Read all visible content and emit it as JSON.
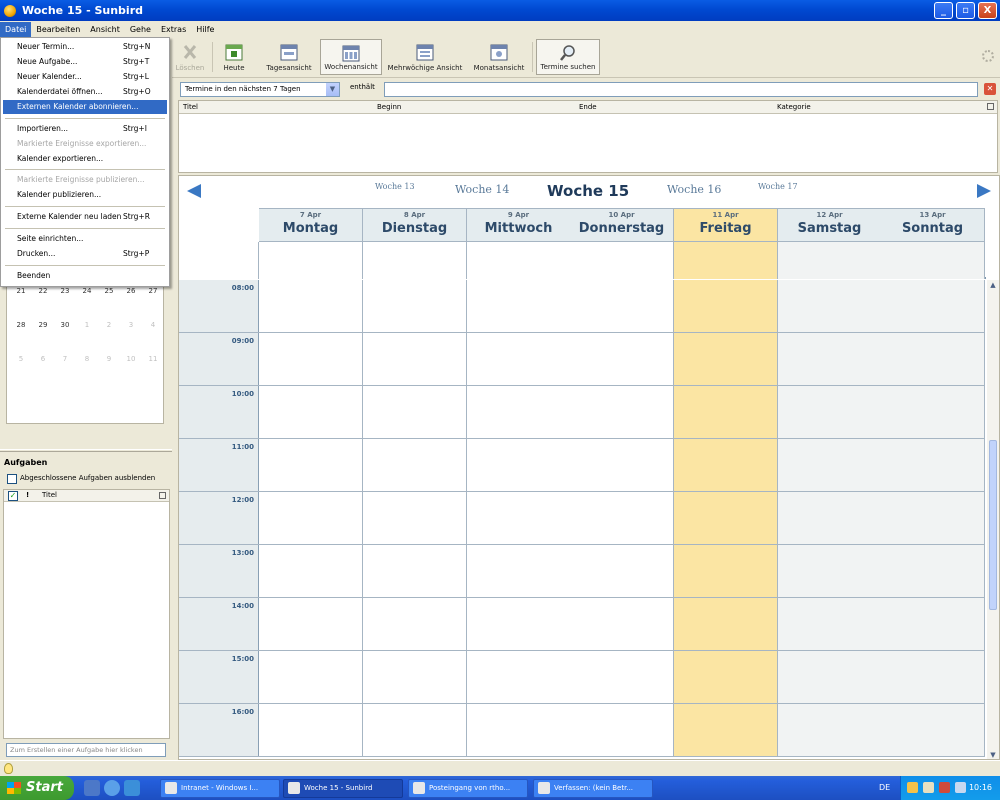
{
  "window": {
    "title": "Woche 15 - Sunbird",
    "min": "_",
    "max": "▫",
    "close": "X"
  },
  "menubar": {
    "items": [
      "Datei",
      "Bearbeiten",
      "Ansicht",
      "Gehe",
      "Extras",
      "Hilfe"
    ]
  },
  "toolbar": {
    "delete_label": "Löschen",
    "today_label": "Heute",
    "day_view_label": "Tagesansicht",
    "week_view_label": "Wochenansicht",
    "multiweek_view_label": "Mehrwöchige Ansicht",
    "month_view_label": "Monatsansicht",
    "search_label": "Termine suchen"
  },
  "filter": {
    "select_value": "Termine in den nächsten 7 Tagen",
    "contains_label": "enthält",
    "input_value": ""
  },
  "event_list": {
    "columns": [
      "Titel",
      "Beginn",
      "Ende",
      "Kategorie"
    ]
  },
  "week_nav": {
    "w13": "Woche 13",
    "w14": "Woche 14",
    "current": "Woche 15",
    "w16": "Woche 16",
    "w17": "Woche 17"
  },
  "days": [
    {
      "date": "7 Apr",
      "name": "Montag"
    },
    {
      "date": "8 Apr",
      "name": "Dienstag"
    },
    {
      "date": "9 Apr",
      "name": "Mittwoch"
    },
    {
      "date": "10 Apr",
      "name": "Donnerstag"
    },
    {
      "date": "11 Apr",
      "name": "Freitag"
    },
    {
      "date": "12 Apr",
      "name": "Samstag"
    },
    {
      "date": "13 Apr",
      "name": "Sonntag"
    }
  ],
  "today_index": 4,
  "times": [
    "08:00",
    "09:00",
    "10:00",
    "11:00",
    "12:00",
    "13:00",
    "14:00",
    "15:00",
    "16:00"
  ],
  "minicalendar": {
    "rows": [
      [
        "21",
        "22",
        "23",
        "24",
        "25",
        "26",
        "27"
      ],
      [
        "28",
        "29",
        "30",
        "1",
        "2",
        "3",
        "4"
      ],
      [
        "5",
        "6",
        "7",
        "8",
        "9",
        "10",
        "11"
      ]
    ]
  },
  "tasks": {
    "title": "Aufgaben",
    "hide_completed_label": "Abgeschlossene Aufgaben ausblenden",
    "col_title": "Titel",
    "priority_mark": "!",
    "new_task_placeholder": "Zum Erstellen einer Aufgabe hier klicken"
  },
  "file_menu": {
    "items": [
      {
        "label": "Neuer Termin...",
        "accel": "Strg+N",
        "disabled": false
      },
      {
        "label": "Neue Aufgabe...",
        "accel": "Strg+T",
        "disabled": false
      },
      {
        "label": "Neuer Kalender...",
        "accel": "Strg+L",
        "disabled": false
      },
      {
        "label": "Kalenderdatei öffnen...",
        "accel": "Strg+O",
        "disabled": false
      },
      {
        "label": "Externen Kalender abonnieren...",
        "accel": "",
        "disabled": false,
        "highlighted": true
      },
      {
        "label": "Importieren...",
        "accel": "Strg+I",
        "disabled": false
      },
      {
        "label": "Markierte Ereignisse exportieren...",
        "accel": "",
        "disabled": true
      },
      {
        "label": "Kalender exportieren...",
        "accel": "",
        "disabled": false
      },
      {
        "label": "Markierte Ereignisse publizieren...",
        "accel": "",
        "disabled": true
      },
      {
        "label": "Kalender publizieren...",
        "accel": "",
        "disabled": false
      },
      {
        "label": "Externe Kalender neu laden",
        "accel": "Strg+R",
        "disabled": false
      },
      {
        "label": "Seite einrichten...",
        "accel": "",
        "disabled": false
      },
      {
        "label": "Drucken...",
        "accel": "Strg+P",
        "disabled": false
      },
      {
        "label": "Beenden",
        "accel": "",
        "disabled": false
      }
    ]
  },
  "taskbar": {
    "start_label": "Start",
    "tasks": [
      "Intranet - Windows I...",
      "Woche 15 - Sunbird",
      "Posteingang von rtho...",
      "Verfassen: (kein Betr..."
    ],
    "active_index": 1,
    "language": "DE",
    "clock": "10:16"
  },
  "colors": {
    "today": "#fbe5a3",
    "weekend": "#f1f3f3",
    "accent": "#316ac5",
    "week_title": "#1f3a5a"
  }
}
